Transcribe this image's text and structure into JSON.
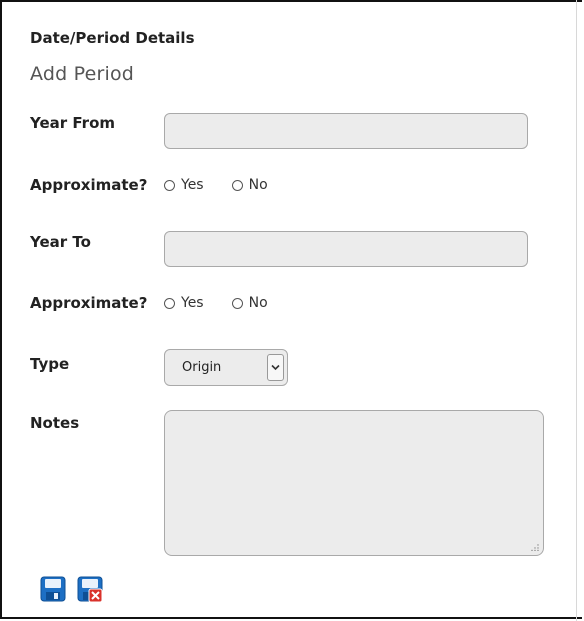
{
  "section": {
    "title": "Date/Period Details",
    "subtitle": "Add Period"
  },
  "form": {
    "year_from": {
      "label": "Year From",
      "value": ""
    },
    "approx_from": {
      "label": "Approximate?",
      "yes": "Yes",
      "no": "No"
    },
    "year_to": {
      "label": "Year To",
      "value": ""
    },
    "approx_to": {
      "label": "Approximate?",
      "yes": "Yes",
      "no": "No"
    },
    "type": {
      "label": "Type",
      "selected": "Origin"
    },
    "notes": {
      "label": "Notes",
      "value": ""
    }
  },
  "actions": {
    "save_icon": "floppy-disk-icon",
    "cancel_icon": "floppy-disk-cancel-icon"
  },
  "colors": {
    "field_bg": "#ececec",
    "icon_blue": "#1d6fc4",
    "cancel_red": "#d9322b"
  }
}
